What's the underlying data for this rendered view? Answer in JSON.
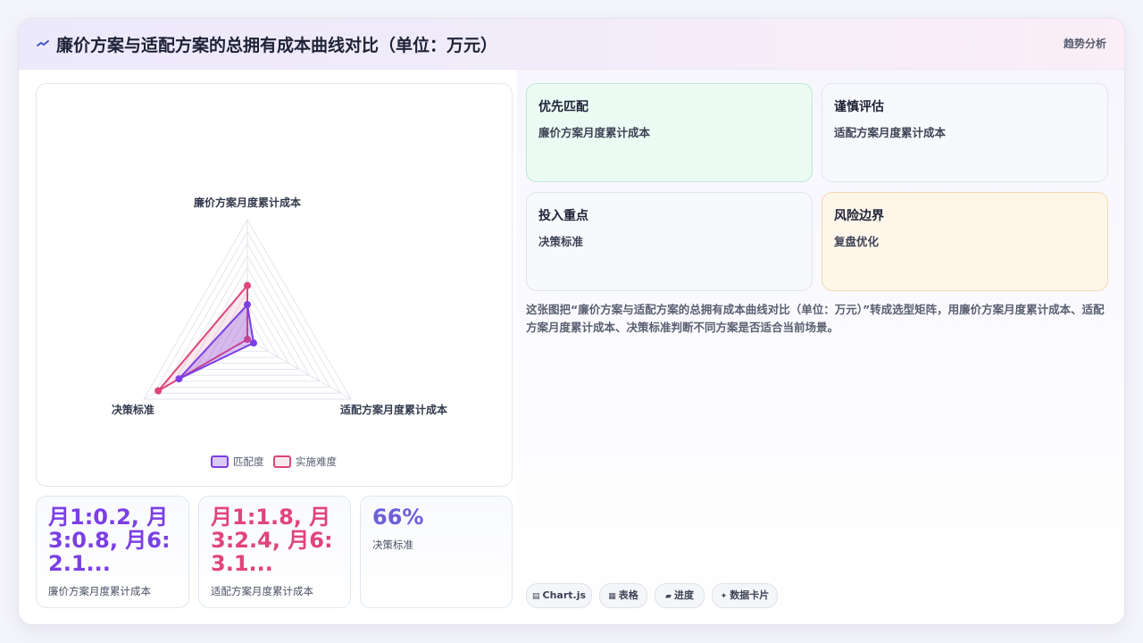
{
  "header": {
    "title": "廉价方案与适配方案的总拥有成本曲线对比（单位：万元）",
    "tag": "趋势分析"
  },
  "chart_data": {
    "type": "radar",
    "axes": [
      "廉价方案月度累计成本",
      "适配方案月度累计成本",
      "决策标准"
    ],
    "series": [
      {
        "name": "匹配度",
        "values": [
          0.29,
          0.06,
          0.66
        ],
        "color": "#7b3fe4"
      },
      {
        "name": "实施难度",
        "values": [
          0.45,
          0.0,
          0.86
        ],
        "color": "#e0457b"
      }
    ]
  },
  "stats": [
    {
      "value": "月1:0.2, 月3:0.8, 月6:2.1...",
      "label": "廉价方案月度累计成本",
      "color": "#7b3fe4"
    },
    {
      "value": "月1:1.8, 月3:2.4, 月6:3.1...",
      "label": "适配方案月度累计成本",
      "color": "#e0457b"
    },
    {
      "value": "66%",
      "label": "决策标准",
      "color": "#6b5fd8"
    }
  ],
  "tiles": [
    {
      "title": "优先匹配",
      "subtitle": "廉价方案月度累计成本",
      "bg": "#ebfbf3",
      "border": "#bfe8d2"
    },
    {
      "title": "谨慎评估",
      "subtitle": "适配方案月度累计成本",
      "bg": "#f8f9fc",
      "border": "#dfe5ef"
    },
    {
      "title": "投入重点",
      "subtitle": "决策标准",
      "bg": "#f8f9fc",
      "border": "#dfe5ef"
    },
    {
      "title": "风险边界",
      "subtitle": "复盘优化",
      "bg": "#fff6ea",
      "border": "#f3d9b0"
    }
  ],
  "description": "这张图把“廉价方案与适配方案的总拥有成本曲线对比（单位：万元）”转成选型矩阵，用廉价方案月度累计成本、适配方案月度累计成本、决策标准判断不同方案是否适合当前场景。",
  "chips": [
    {
      "icon": "▤",
      "label": "Chart.js"
    },
    {
      "icon": "▦",
      "label": "表格"
    },
    {
      "icon": "▰",
      "label": "进度"
    },
    {
      "icon": "✦",
      "label": "数据卡片"
    }
  ]
}
